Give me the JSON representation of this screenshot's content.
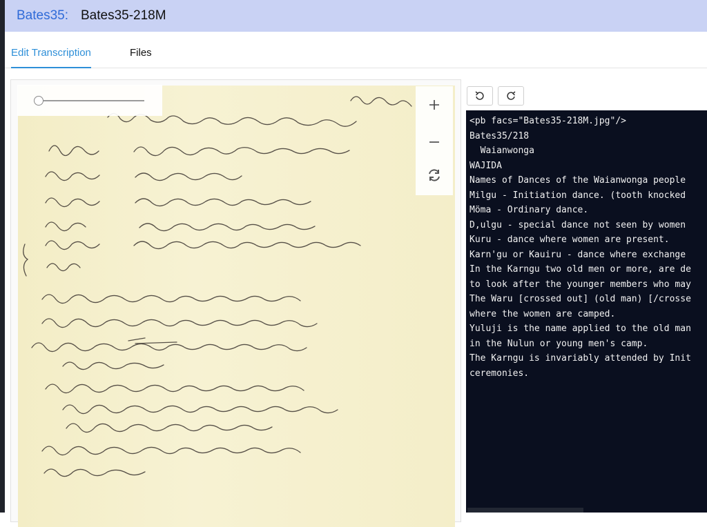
{
  "header": {
    "collection": "Bates35:",
    "page_id": "Bates35-218M"
  },
  "tabs": [
    {
      "label": "Edit Transcription",
      "active": true
    },
    {
      "label": "Files",
      "active": false
    }
  ],
  "viewer": {
    "zoom_in_icon": "plus-icon",
    "zoom_out_icon": "minus-icon",
    "reset_icon": "refresh-icon",
    "slider_value": 0,
    "manuscript_lines": [
      "35/218",
      "Waianwonga",
      "Names of Dances of the Waianwonga people",
      "Milgu - Initiation dance. (tooth knocked out at Milgu)",
      "Möma - Ordinary dance.",
      "D,ulgu - Special dance not seen by women.",
      "Kuru - dance where women are present.",
      "Karngu - dance where exchange of women may take place",
      "or",
      "Kauiru",
      "In the Karngu two old men or more, are deputed",
      "to look after the younger members who may be exchanged",
      "The Waru (old man) guards the Mirilji or enclosure",
      "where the women are camped.",
      "Yuluji is the name applied to the old man or men",
      "who have charge of all the younger men & boys",
      "in the Nulun or young men's camp.",
      "The Karngu is invariably attended by Initiation",
      "ceremonies."
    ]
  },
  "toolbar": {
    "undo_icon": "undo-icon",
    "redo_icon": "redo-icon"
  },
  "editor": {
    "lines": [
      "<pb facs=\"Bates35-218M.jpg\"/>",
      "Bates35/218",
      "  Waianwonga",
      "WAJIDA",
      "Names of Dances of the Waianwonga people",
      "Milgu - Initiation dance. (tooth knocked",
      "Möma - Ordinary dance.",
      "D,ulgu - special dance not seen by women",
      "Kuru - dance where women are present.",
      "Karn'gu or Kauiru - dance where exchange",
      "In the Karngu two old men or more, are de",
      "to look after the younger members who may",
      "The Waru [crossed out] (old man) [/crosse",
      "where the women are camped.",
      "Yuluji is the name applied to the old man",
      "in the Nulun or young men's camp.",
      "The Karngu is invariably attended by Init",
      "ceremonies."
    ]
  },
  "colors": {
    "header_bg": "#c9d2f4",
    "accent": "#2e8fd8",
    "editor_bg": "#0a0f1f",
    "paper": "#f6f1cf"
  }
}
